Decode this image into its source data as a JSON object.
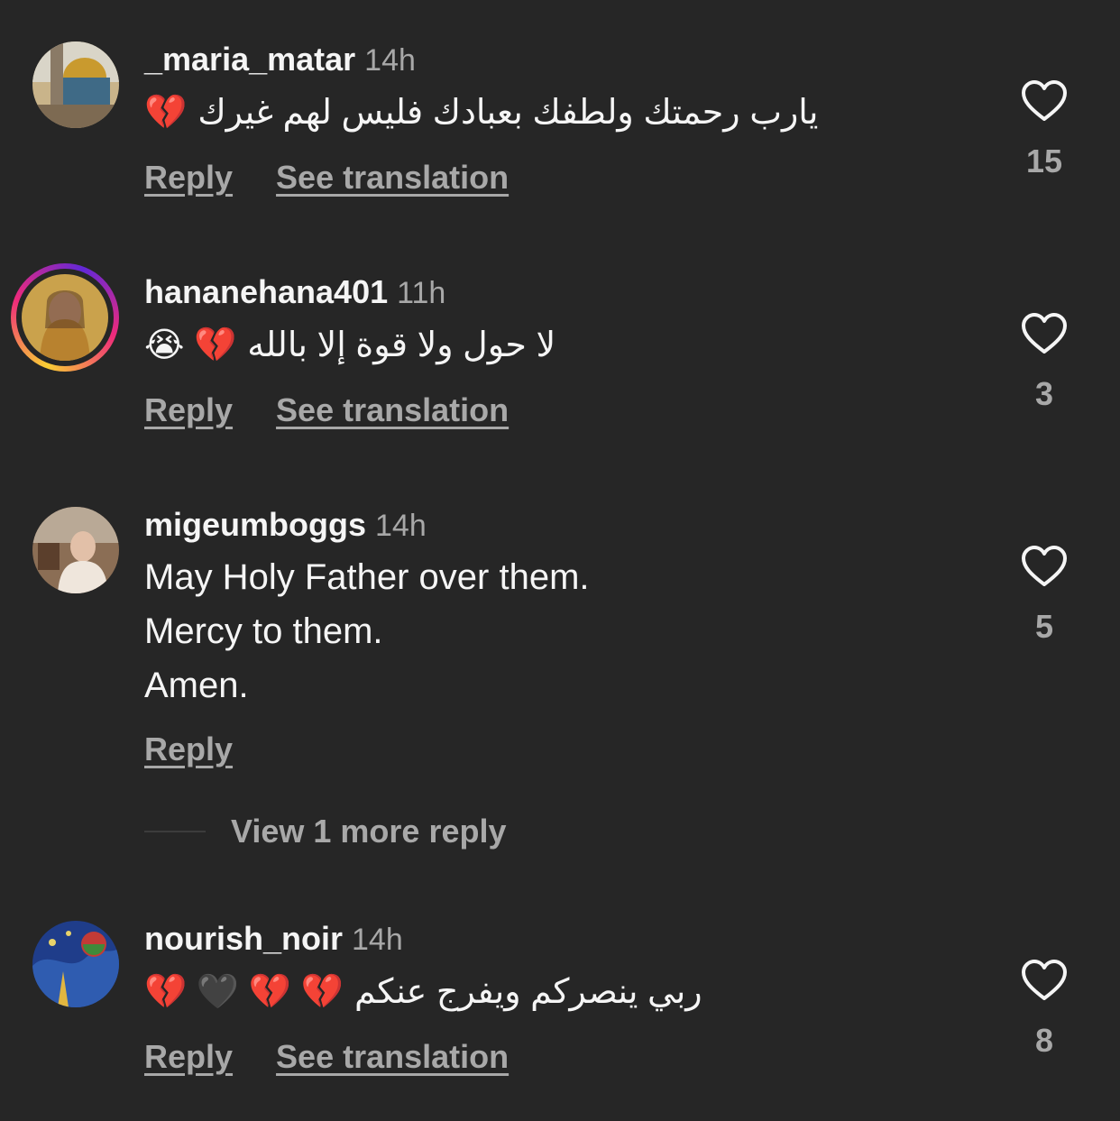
{
  "comments": [
    {
      "username": "_maria_matar",
      "time": "14h",
      "text": "يارب رحمتك ولطفك بعبادك فليس لهم غيرك",
      "emoji": "💔",
      "reply_label": "Reply",
      "translate_label": "See translation",
      "likes": "15"
    },
    {
      "username": "hananehana401",
      "time": "11h",
      "text": "لا حول ولا قوة إلا بالله",
      "emoji": "😭 💔",
      "reply_label": "Reply",
      "translate_label": "See translation",
      "likes": "3"
    },
    {
      "username": "migeumboggs",
      "time": "14h",
      "lines": [
        "May Holy Father over them.",
        "Mercy to them.",
        "Amen."
      ],
      "reply_label": "Reply",
      "likes": "5"
    },
    {
      "username": "nourish_noir",
      "time": "14h",
      "text": "ربي ينصركم ويفرج عنكم",
      "emoji": "💔 🖤 💔 💔",
      "reply_label": "Reply",
      "translate_label": "See translation",
      "likes": "8"
    }
  ],
  "more_replies_label": "View 1 more reply",
  "colors": {
    "background": "#262626",
    "primary_text": "#f5f5f5",
    "secondary_text": "#a8a8a8"
  },
  "icons": {
    "like": "heart-outline-icon"
  }
}
